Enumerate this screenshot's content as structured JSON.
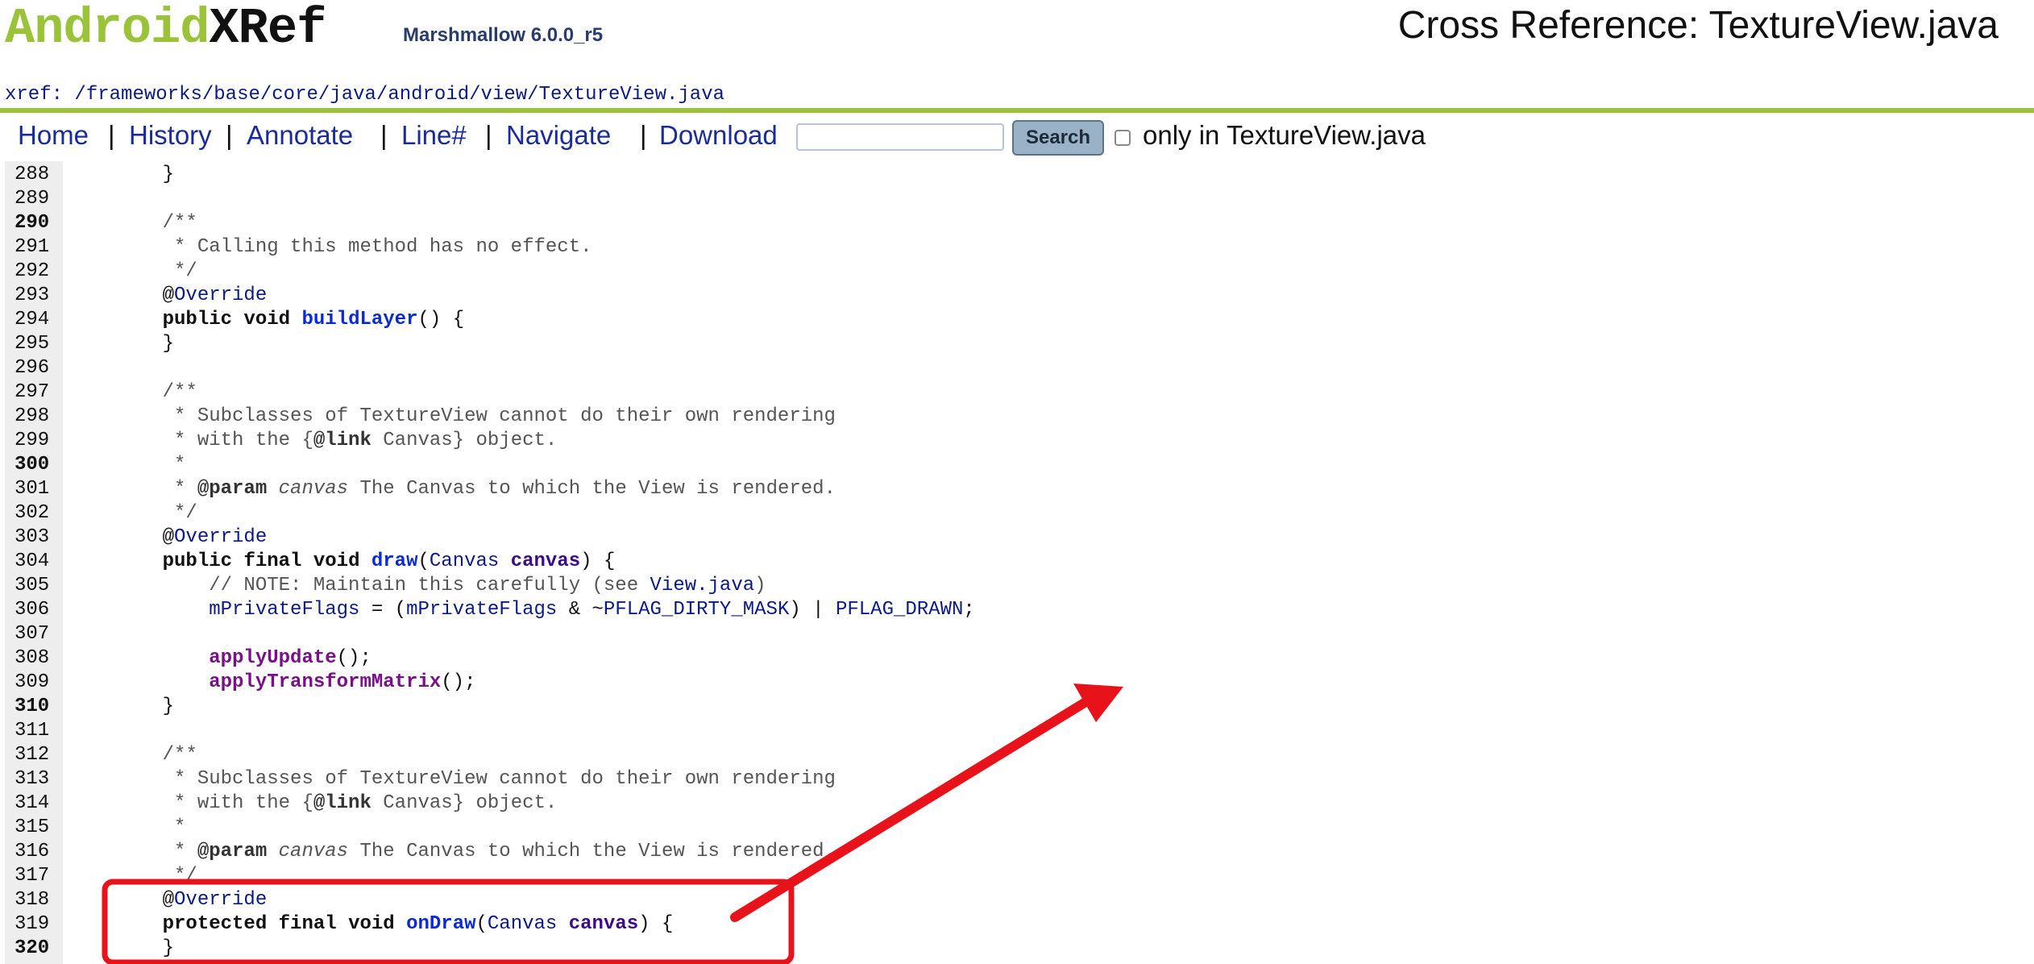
{
  "header": {
    "logo_android": "Android",
    "logo_xref": "XRef",
    "logo_version": "Marshmallow 6.0.0_r5",
    "title": "Cross Reference: TextureView.java"
  },
  "breadcrumb": {
    "prefix": "xref",
    "colon": ":",
    "segments": [
      "frameworks",
      "base",
      "core",
      "java",
      "android",
      "view",
      "TextureView.java"
    ]
  },
  "menu": {
    "items": [
      "Home",
      "History",
      "Annotate",
      "Line#",
      "Navigate",
      "Download"
    ],
    "search_value": "",
    "search_button": "Search",
    "only_in_label": "only in TextureView.java",
    "only_in_checked": false
  },
  "code": {
    "lines": [
      {
        "n": "288",
        "bold": false,
        "text": "    }"
      },
      {
        "n": "289",
        "bold": false,
        "text": ""
      },
      {
        "n": "290",
        "bold": true,
        "text": "    /**"
      },
      {
        "n": "291",
        "bold": false,
        "text": "     * Calling this method has no effect."
      },
      {
        "n": "292",
        "bold": false,
        "text": "     */"
      },
      {
        "n": "293",
        "bold": false,
        "text": "    @Override"
      },
      {
        "n": "294",
        "bold": false,
        "text": "    public void buildLayer() {"
      },
      {
        "n": "295",
        "bold": false,
        "text": "    }"
      },
      {
        "n": "296",
        "bold": false,
        "text": ""
      },
      {
        "n": "297",
        "bold": false,
        "text": "    /**"
      },
      {
        "n": "298",
        "bold": false,
        "text": "     * Subclasses of TextureView cannot do their own rendering"
      },
      {
        "n": "299",
        "bold": false,
        "text": "     * with the {@link Canvas} object."
      },
      {
        "n": "300",
        "bold": true,
        "text": "     *"
      },
      {
        "n": "301",
        "bold": false,
        "text": "     * @param canvas The Canvas to which the View is rendered."
      },
      {
        "n": "302",
        "bold": false,
        "text": "     */"
      },
      {
        "n": "303",
        "bold": false,
        "text": "    @Override"
      },
      {
        "n": "304",
        "bold": false,
        "text": "    public final void draw(Canvas canvas) {"
      },
      {
        "n": "305",
        "bold": false,
        "text": "        // NOTE: Maintain this carefully (see View.java)"
      },
      {
        "n": "306",
        "bold": false,
        "text": "        mPrivateFlags = (mPrivateFlags & ~PFLAG_DIRTY_MASK) | PFLAG_DRAWN;"
      },
      {
        "n": "307",
        "bold": false,
        "text": ""
      },
      {
        "n": "308",
        "bold": false,
        "text": "        applyUpdate();"
      },
      {
        "n": "309",
        "bold": false,
        "text": "        applyTransformMatrix();"
      },
      {
        "n": "310",
        "bold": true,
        "text": "    }"
      },
      {
        "n": "311",
        "bold": false,
        "text": ""
      },
      {
        "n": "312",
        "bold": false,
        "text": "    /**"
      },
      {
        "n": "313",
        "bold": false,
        "text": "     * Subclasses of TextureView cannot do their own rendering"
      },
      {
        "n": "314",
        "bold": false,
        "text": "     * with the {@link Canvas} object."
      },
      {
        "n": "315",
        "bold": false,
        "text": "     *"
      },
      {
        "n": "316",
        "bold": false,
        "text": "     * @param canvas The Canvas to which the View is rendered."
      },
      {
        "n": "317",
        "bold": false,
        "text": "     */"
      },
      {
        "n": "318",
        "bold": false,
        "text": "    @Override"
      },
      {
        "n": "319",
        "bold": false,
        "text": "    protected final void onDraw(Canvas canvas) {"
      },
      {
        "n": "320",
        "bold": true,
        "text": "    }"
      }
    ]
  },
  "annotation": {
    "color": "#e8121b",
    "shapes": [
      "highlight-box",
      "arrow"
    ]
  },
  "colors": {
    "brand_green": "#9ac33a",
    "link_blue": "#1a2b9a",
    "gutter_gray": "#eeeeee"
  }
}
